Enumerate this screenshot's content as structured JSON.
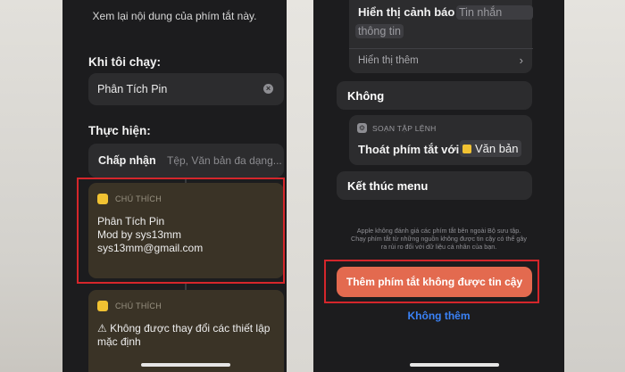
{
  "left": {
    "review_text": "Xem lại nội dung của phím tắt này.",
    "when_run_label": "Khi tôi chạy:",
    "run_value": "Phân Tích Pin",
    "perform_label": "Thực hiện:",
    "accept_label": "Chấp nhận",
    "accept_placeholder": "Tệp, Văn bản đa dạng...",
    "comment1": {
      "header": "CHÚ THÍCH",
      "lines": [
        "Phân Tích Pin",
        "Mod by sys13mm",
        "sys13mm@gmail.com"
      ]
    },
    "comment2": {
      "header": "CHÚ THÍCH",
      "lines": [
        "⚠ Không được thay đổi các thiết lập",
        "mặc định"
      ]
    }
  },
  "right": {
    "alert_label": "Hiển thị cảnh báo",
    "alert_token1": "Tin nhắn",
    "alert_token2": "thông tin",
    "show_more": "Hiển thị thêm",
    "otherwise_label": "Không",
    "script_header": "SOẠN TẬP LỆNH",
    "exit_label": "Thoát phím tắt với",
    "exit_value": "Văn bản",
    "end_menu": "Kết thúc menu",
    "disclaimer": [
      "Apple không đánh giá các phím tắt bên ngoài Bộ sưu tập.",
      "Chạy phím tắt từ những nguồn không được tin cậy có thể gây",
      "ra rủi ro đối với dữ liệu cá nhân của bạn."
    ],
    "add_button": "Thêm phím tắt không được tin cậy",
    "no_add_button": "Không thêm"
  },
  "colors": {
    "highlight": "#d5262b",
    "add_button": "#e36a4f",
    "link": "#3a82f7",
    "note_icon": "#f1c232"
  },
  "icons": [
    "clear-icon",
    "note-icon",
    "chevron-right-icon",
    "gear-icon"
  ]
}
